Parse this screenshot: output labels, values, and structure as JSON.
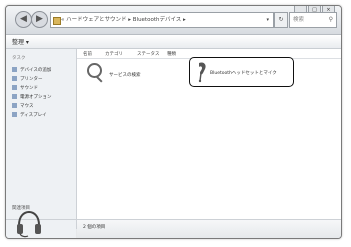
{
  "address": {
    "path": "« ハードウェアとサウンド ▸ Bluetoothデバイス ▸",
    "search_placeholder": "検索"
  },
  "toolbar": {
    "organize_label": "整理 ▾"
  },
  "navpane": {
    "title": "タスク",
    "items": [
      {
        "label": "デバイスの追加"
      },
      {
        "label": "プリンター"
      },
      {
        "label": "サウンド"
      },
      {
        "label": "電源オプション"
      },
      {
        "label": "マウス"
      },
      {
        "label": "ディスプレイ"
      }
    ],
    "see_also": "関連項目"
  },
  "content": {
    "columns": [
      "名前",
      "カテゴリ",
      "ステータス",
      "種類"
    ],
    "items": [
      {
        "label": "サービスの検索",
        "icon": "magnifier-icon"
      },
      {
        "label": "Bluetoothヘッドセットとマイク",
        "icon": "headset-icon"
      }
    ]
  },
  "statusbar": {
    "count": "2 個の項目"
  }
}
